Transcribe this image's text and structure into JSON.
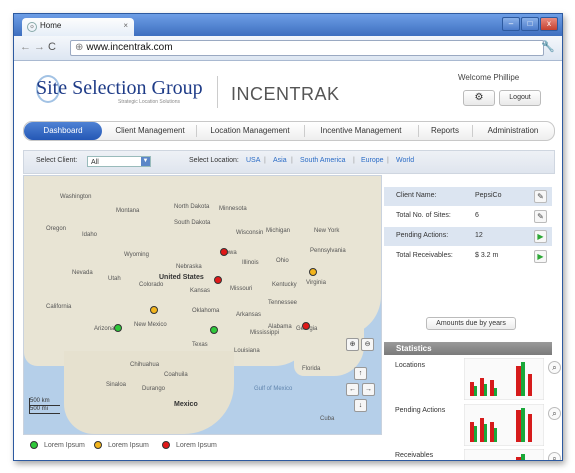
{
  "browser": {
    "tab_title": "Home",
    "tab_close": "×",
    "url": "www.incentrak.com",
    "window_buttons": [
      "–",
      "□",
      "x"
    ]
  },
  "header": {
    "logo_primary": "Site Selection Group",
    "logo_tagline": "Strategic Location Solutions",
    "logo_secondary": "INCENTRAK",
    "welcome": "Welcome Phillipe",
    "logout_label": "Logout"
  },
  "nav": {
    "items": [
      "Dashboard",
      "Client Management",
      "Location Management",
      "Incentive Management",
      "Reports",
      "Administration"
    ],
    "active": "Dashboard"
  },
  "filters": {
    "client_label": "Select Client:",
    "client_value": "All",
    "location_label": "Select Location:",
    "locations": [
      "USA",
      "Asia",
      "South America",
      "Europe",
      "World"
    ]
  },
  "map": {
    "country_label": "United States",
    "gulf_label": "Gulf of Mexico",
    "mexico_label": "Mexico",
    "states": [
      "Washington",
      "Montana",
      "North Dakota",
      "Minnesota",
      "Oregon",
      "Idaho",
      "South Dakota",
      "Wisconsin",
      "Michigan",
      "Wyoming",
      "Iowa",
      "Nebraska",
      "Illinois",
      "Ohio",
      "Nevada",
      "Utah",
      "Colorado",
      "Kansas",
      "Missouri",
      "Kentucky",
      "California",
      "Oklahoma",
      "Arkansas",
      "Tennessee",
      "Arizona",
      "New Mexico",
      "Mississippi",
      "Alabama",
      "Georgia",
      "Texas",
      "Louisiana",
      "Florida",
      "Virginia",
      "Pennsylvania",
      "New York",
      "Chihuahua",
      "Coahuila",
      "Sinaloa",
      "Durango",
      "Cuba"
    ],
    "scale_km": "500 km",
    "scale_mi": "500 mi",
    "controls": [
      "⊕",
      "⊖",
      "↑",
      "←",
      "→",
      "↓"
    ]
  },
  "legend": [
    {
      "label": "Lorem Ipsum",
      "color": "#2fc83a"
    },
    {
      "label": "Lorem Ipsum",
      "color": "#f2b41c"
    },
    {
      "label": "Lorem Ipsum",
      "color": "#e01818"
    }
  ],
  "details": {
    "rows": [
      {
        "key": "Client Name:",
        "value": "PepsiCo",
        "icon": "wrench-icon"
      },
      {
        "key": "Total No. of Sites:",
        "value": "6",
        "icon": "wrench-icon"
      },
      {
        "key": "Pending Actions:",
        "value": "12",
        "icon": "play-icon"
      },
      {
        "key": "Total Receivables:",
        "value": "$ 3.2 m",
        "icon": "play-icon"
      }
    ],
    "amounts_button": "Amounts due by years"
  },
  "statistics": {
    "title": "Statistics",
    "items": [
      "Locations",
      "Pending Actions",
      "Receivables"
    ]
  },
  "colors": {
    "accent": "#2457b5",
    "pin_red": "#e01818",
    "pin_green": "#2fc83a",
    "pin_yellow": "#f2b41c"
  }
}
